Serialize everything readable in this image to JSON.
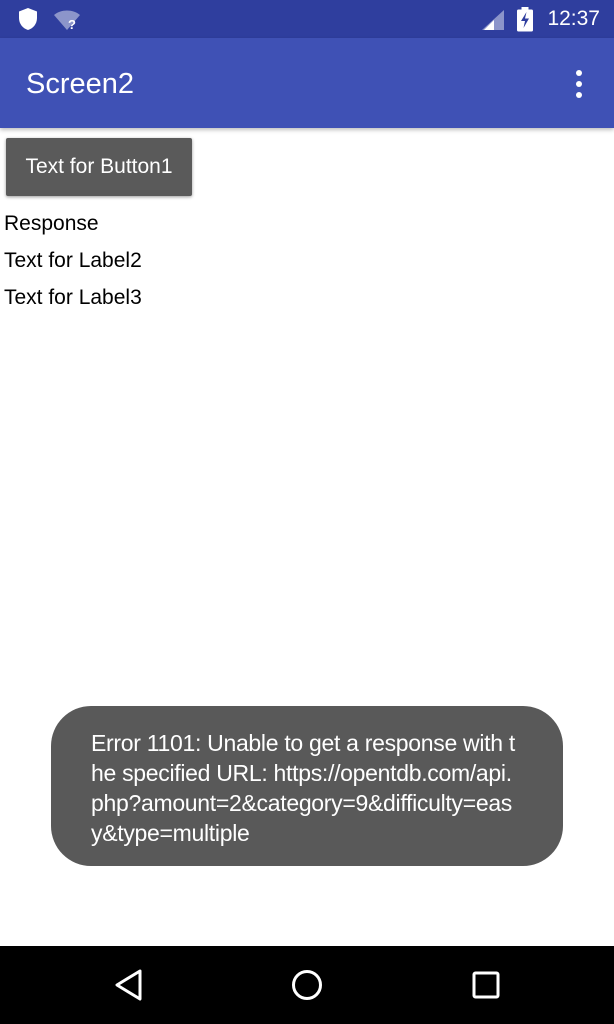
{
  "status_bar": {
    "time": "12:37",
    "icons": [
      "shield-icon",
      "wifi-unknown-icon",
      "cell-signal-icon",
      "battery-charging-icon"
    ],
    "wifi_badge": "?"
  },
  "app_bar": {
    "title": "Screen2",
    "overflow_icon": "more-vert-icon",
    "color": "#3f51b5"
  },
  "content": {
    "button1_label": "Text for Button1",
    "labels": [
      "Response",
      "Text for Label2",
      "Text for Label3"
    ]
  },
  "toast": {
    "message": "Error 1101: Unable to get a response with the specified URL: https://opentdb.com/api.php?amount=2&category=9&difficulty=easy&type=multiple"
  },
  "nav_bar": {
    "icons": [
      "back-icon",
      "home-icon",
      "recents-icon"
    ]
  },
  "colors": {
    "status_bar": "#2f3e9e",
    "app_bar": "#3f51b5",
    "button": "#5a5a5a",
    "toast": "#595959"
  }
}
